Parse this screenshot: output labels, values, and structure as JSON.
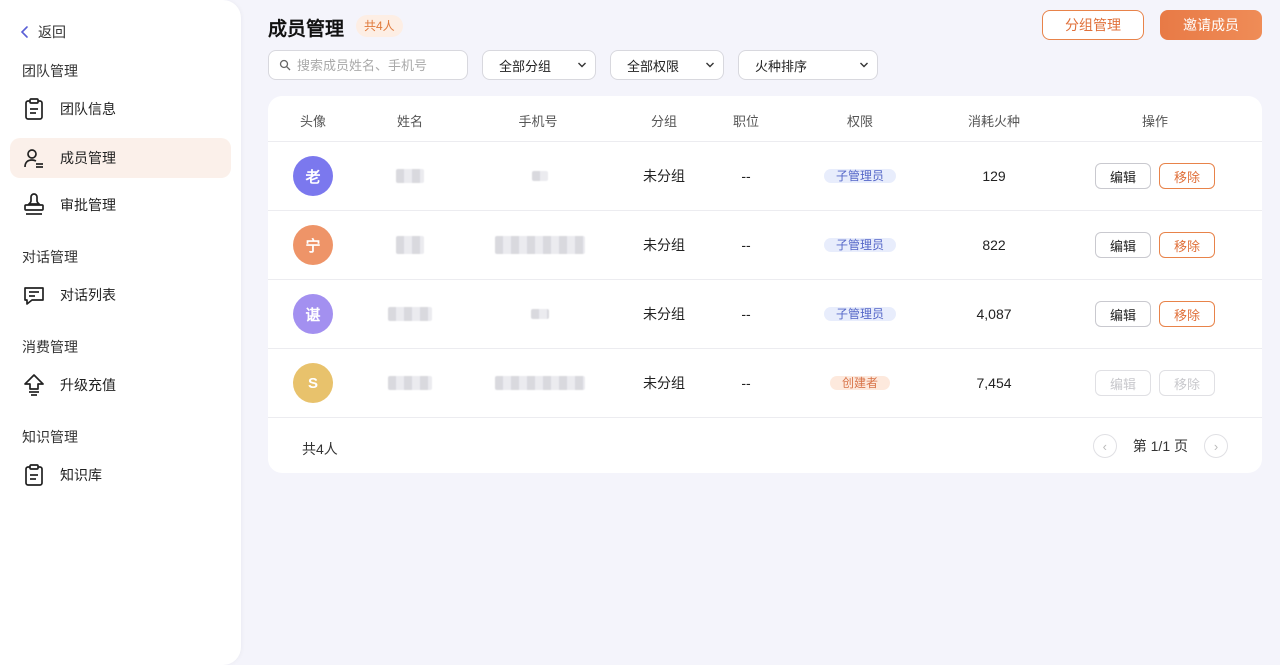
{
  "sidebar": {
    "back_label": "返回",
    "sections": [
      {
        "title": "团队管理",
        "items": [
          {
            "label": "团队信息",
            "icon": "clipboard-icon"
          },
          {
            "label": "成员管理",
            "icon": "user-manage-icon"
          },
          {
            "label": "审批管理",
            "icon": "stamp-icon"
          }
        ]
      },
      {
        "title": "对话管理",
        "items": [
          {
            "label": "对话列表",
            "icon": "chat-icon"
          }
        ]
      },
      {
        "title": "消费管理",
        "items": [
          {
            "label": "升级充值",
            "icon": "upgrade-icon"
          }
        ]
      },
      {
        "title": "知识管理",
        "items": [
          {
            "label": "知识库",
            "icon": "clipboard-icon"
          }
        ]
      }
    ],
    "active_item": "成员管理"
  },
  "header": {
    "title": "成员管理",
    "count_badge": "共4人",
    "group_button": "分组管理",
    "invite_button": "邀请成员"
  },
  "filters": {
    "search_placeholder": "搜索成员姓名、手机号",
    "group_select": "全部分组",
    "permission_select": "全部权限",
    "sort_select": "火种排序"
  },
  "table": {
    "columns": [
      "头像",
      "姓名",
      "手机号",
      "分组",
      "职位",
      "权限",
      "消耗火种",
      "操作"
    ],
    "rows": [
      {
        "avatar_char": "老",
        "avatar_color": "#7b78ee",
        "group": "未分组",
        "position": "--",
        "role": "子管理员",
        "role_type": "admin",
        "consumption": "129",
        "edit": "编辑",
        "remove": "移除",
        "enabled": true
      },
      {
        "avatar_char": "宁",
        "avatar_color": "#ee9468",
        "group": "未分组",
        "position": "--",
        "role": "子管理员",
        "role_type": "admin",
        "consumption": "822",
        "edit": "编辑",
        "remove": "移除",
        "enabled": true
      },
      {
        "avatar_char": "谌",
        "avatar_color": "#a390f0",
        "group": "未分组",
        "position": "--",
        "role": "子管理员",
        "role_type": "admin",
        "consumption": "4,087",
        "edit": "编辑",
        "remove": "移除",
        "enabled": true
      },
      {
        "avatar_char": "S",
        "avatar_color": "#e8c26c",
        "group": "未分组",
        "position": "--",
        "role": "创建者",
        "role_type": "creator",
        "consumption": "7,454",
        "edit": "编辑",
        "remove": "移除",
        "enabled": false
      }
    ],
    "footer_total": "共4人",
    "pagination": "第 1/1 页"
  }
}
